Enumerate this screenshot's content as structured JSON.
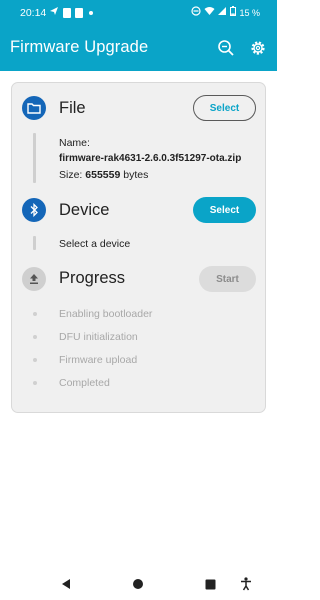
{
  "status_bar": {
    "time": "20:14",
    "battery": "15 %",
    "icons": [
      "send-icon",
      "lock-icon",
      "message-icon",
      "dot-icon",
      "dnd-icon",
      "wifi-icon",
      "signal-icon",
      "battery-icon"
    ]
  },
  "app_bar": {
    "title": "Firmware Upgrade",
    "actions": [
      "search-zoom-icon",
      "settings-icon"
    ]
  },
  "file_step": {
    "title": "File",
    "icon": "folder-icon",
    "button_label": "Select",
    "name_label": "Name:",
    "file_name": "firmware-rak4631-2.6.0.3f51297-ota.zip",
    "size_label": "Size:",
    "size_value": "655559",
    "size_unit": "bytes"
  },
  "device_step": {
    "title": "Device",
    "icon": "bluetooth-icon",
    "button_label": "Select",
    "status": "Select a device"
  },
  "progress_step": {
    "title": "Progress",
    "icon": "upload-icon",
    "button_label": "Start",
    "items": [
      "Enabling bootloader",
      "DFU initialization",
      "Firmware upload",
      "Completed"
    ]
  },
  "colors": {
    "primary": "#0aa4c8",
    "step_active": "#1466b8",
    "step_inactive": "#cfcfcf"
  },
  "nav_bar": {
    "buttons": [
      "back-icon",
      "home-icon",
      "recents-icon",
      "accessibility-icon"
    ]
  }
}
